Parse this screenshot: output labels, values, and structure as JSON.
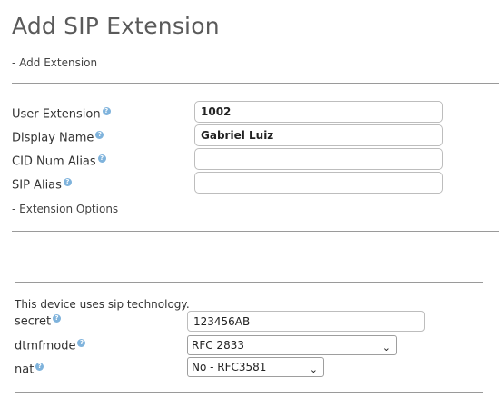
{
  "header": {
    "title": "Add SIP Extension"
  },
  "sections": {
    "add_extension": "- Add Extension",
    "extension_options": "- Extension Options"
  },
  "fields": {
    "user_extension": {
      "label": "User Extension",
      "value": "1002"
    },
    "display_name": {
      "label": "Display Name",
      "value": "Gabriel Luiz"
    },
    "cid_num_alias": {
      "label": "CID Num Alias",
      "value": ""
    },
    "sip_alias": {
      "label": "SIP Alias",
      "value": ""
    }
  },
  "device": {
    "note": "This device uses sip technology.",
    "secret": {
      "label": "secret",
      "value": "123456AB"
    },
    "dtmfmode": {
      "label": "dtmfmode",
      "selected": "RFC 2833"
    },
    "nat": {
      "label": "nat",
      "selected": "No - RFC3581"
    }
  },
  "icons": {
    "help": "?",
    "chevron": "⌄"
  },
  "colors": {
    "help_icon": "#7fb3dc",
    "divider": "#9a9a9a"
  }
}
